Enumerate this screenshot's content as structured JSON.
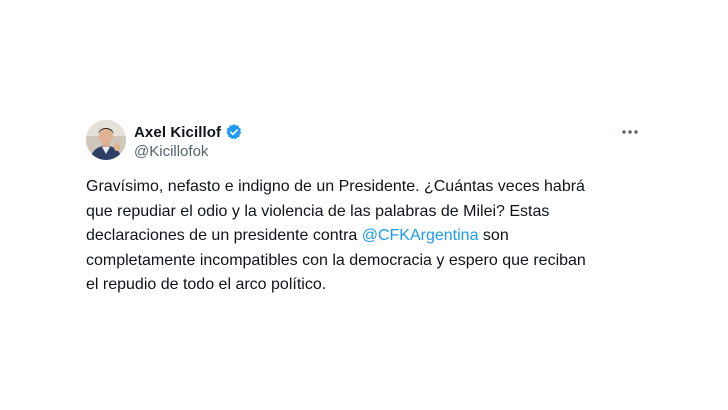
{
  "author": {
    "display_name": "Axel Kicillof",
    "handle": "@Kicillofok",
    "verified": true,
    "verified_color": "#1d9bf0"
  },
  "tweet": {
    "line1": "Gravísimo, nefasto e indigno de un Presidente. ¿Cuántas veces habrá",
    "line2": "que repudiar el odio y la violencia de las palabras de Milei? Estas",
    "line3_prefix": "declaraciones de un presidente contra ",
    "mention": "@CFKArgentina",
    "line3_suffix": " son",
    "line4": "completamente incompatibles con la democracia y espero que reciban",
    "line5": "el repudio de todo el arco político."
  },
  "icons": {
    "more": "more-options-icon",
    "verified": "verified-badge-icon",
    "avatar": "profile-avatar"
  },
  "colors": {
    "text": "#0f1419",
    "secondary": "#536471",
    "link": "#1d9bf0",
    "background": "#ffffff"
  }
}
